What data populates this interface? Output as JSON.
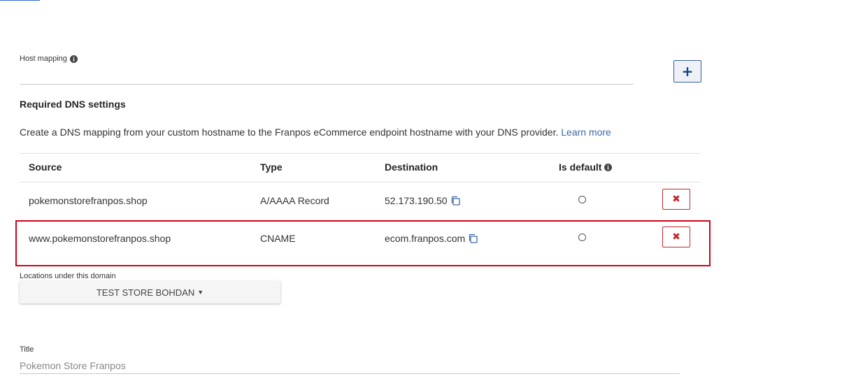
{
  "host_mapping": {
    "label": "Host mapping",
    "add_button": "+"
  },
  "dns": {
    "heading": "Required DNS settings",
    "description": "Create a DNS mapping from your custom hostname to the Franpos eCommerce endpoint hostname with your DNS provider.",
    "learn_more": "Learn more",
    "columns": {
      "source": "Source",
      "type": "Type",
      "destination": "Destination",
      "is_default": "Is default"
    },
    "rows": [
      {
        "source": "pokemonstorefranpos.shop",
        "type": "A/AAAA Record",
        "destination": "52.173.190.50",
        "delete": "✖"
      },
      {
        "source": "www.pokemonstorefranpos.shop",
        "type": "CNAME",
        "destination": "ecom.franpos.com",
        "delete": "✖"
      }
    ]
  },
  "locations": {
    "label": "Locations under this domain",
    "selected": "TEST STORE BOHDAN"
  },
  "title_field": {
    "label": "Title",
    "placeholder": "Pokemon Store Franpos"
  },
  "colors": {
    "accent": "#3b5ba5",
    "danger": "#c62828",
    "highlight": "#d0021b",
    "link": "#3d66a8"
  },
  "icons": {
    "info": "info-icon",
    "copy": "copy-icon",
    "delete": "times-icon",
    "caret": "caret-down-icon"
  }
}
